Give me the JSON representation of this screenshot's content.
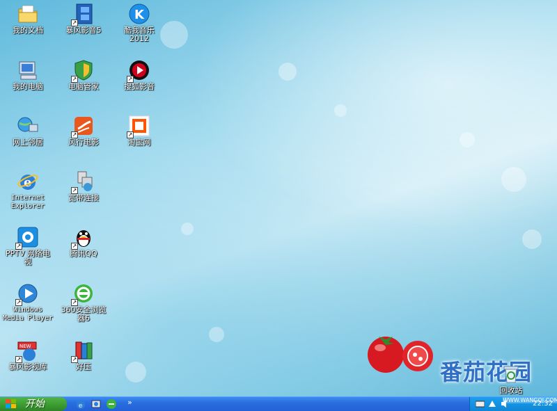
{
  "desktop_icons": [
    {
      "name": "my-documents",
      "label": "我的文档"
    },
    {
      "name": "baofeng-5",
      "label": "暴风影音5"
    },
    {
      "name": "kuwo-music",
      "label": "酷我音乐\n2012"
    },
    {
      "name": "my-computer",
      "label": "我的电脑"
    },
    {
      "name": "pc-manager",
      "label": "电脑管家"
    },
    {
      "name": "sohu-video",
      "label": "搜狐影音"
    },
    {
      "name": "network-places",
      "label": "网上邻居"
    },
    {
      "name": "fengxing",
      "label": "风行电影"
    },
    {
      "name": "taobao",
      "label": "淘宝网"
    },
    {
      "name": "internet-explorer",
      "label": "Internet\nExplorer"
    },
    {
      "name": "broadband",
      "label": "宽带连接"
    },
    {
      "name": "pptv",
      "label": "PPTV 网络电\n视"
    },
    {
      "name": "tencent-qq",
      "label": "腾讯QQ"
    },
    {
      "name": "windows-media-player",
      "label": "Windows\nMedia Player"
    },
    {
      "name": "360-browser",
      "label": "360安全浏览\n器6"
    },
    {
      "name": "baofeng-library",
      "label": "暴风影视库"
    },
    {
      "name": "haozip",
      "label": "好压"
    },
    {
      "name": "recycle-bin",
      "label": "回收站"
    }
  ],
  "brand": {
    "text": "番茄花园"
  },
  "taskbar": {
    "start_label": "开始",
    "chevron": "»",
    "clock": "22:32",
    "watermark": "WWW.WANGQI.COM"
  },
  "colors": {
    "taskbar": "#2a6ee0",
    "start": "#3a9a30",
    "brand": "#2f6fc6"
  }
}
